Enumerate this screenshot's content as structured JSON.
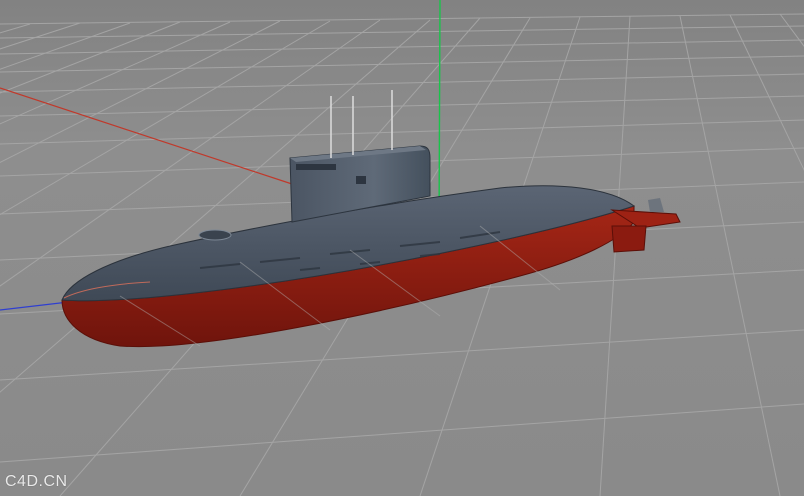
{
  "viewport": {
    "background": "#8b8b8b",
    "grid_color": "#a6a6a6",
    "axes": {
      "x_axis_color": "#c0392b",
      "y_axis_color": "#19c44a",
      "z_axis_color": "#2f3fd0"
    }
  },
  "model": {
    "hull_top_color": "#4a5563",
    "hull_bottom_color": "#8e1b10",
    "sail_color": "#56616f"
  },
  "watermark": {
    "text": "C4D.CN"
  }
}
